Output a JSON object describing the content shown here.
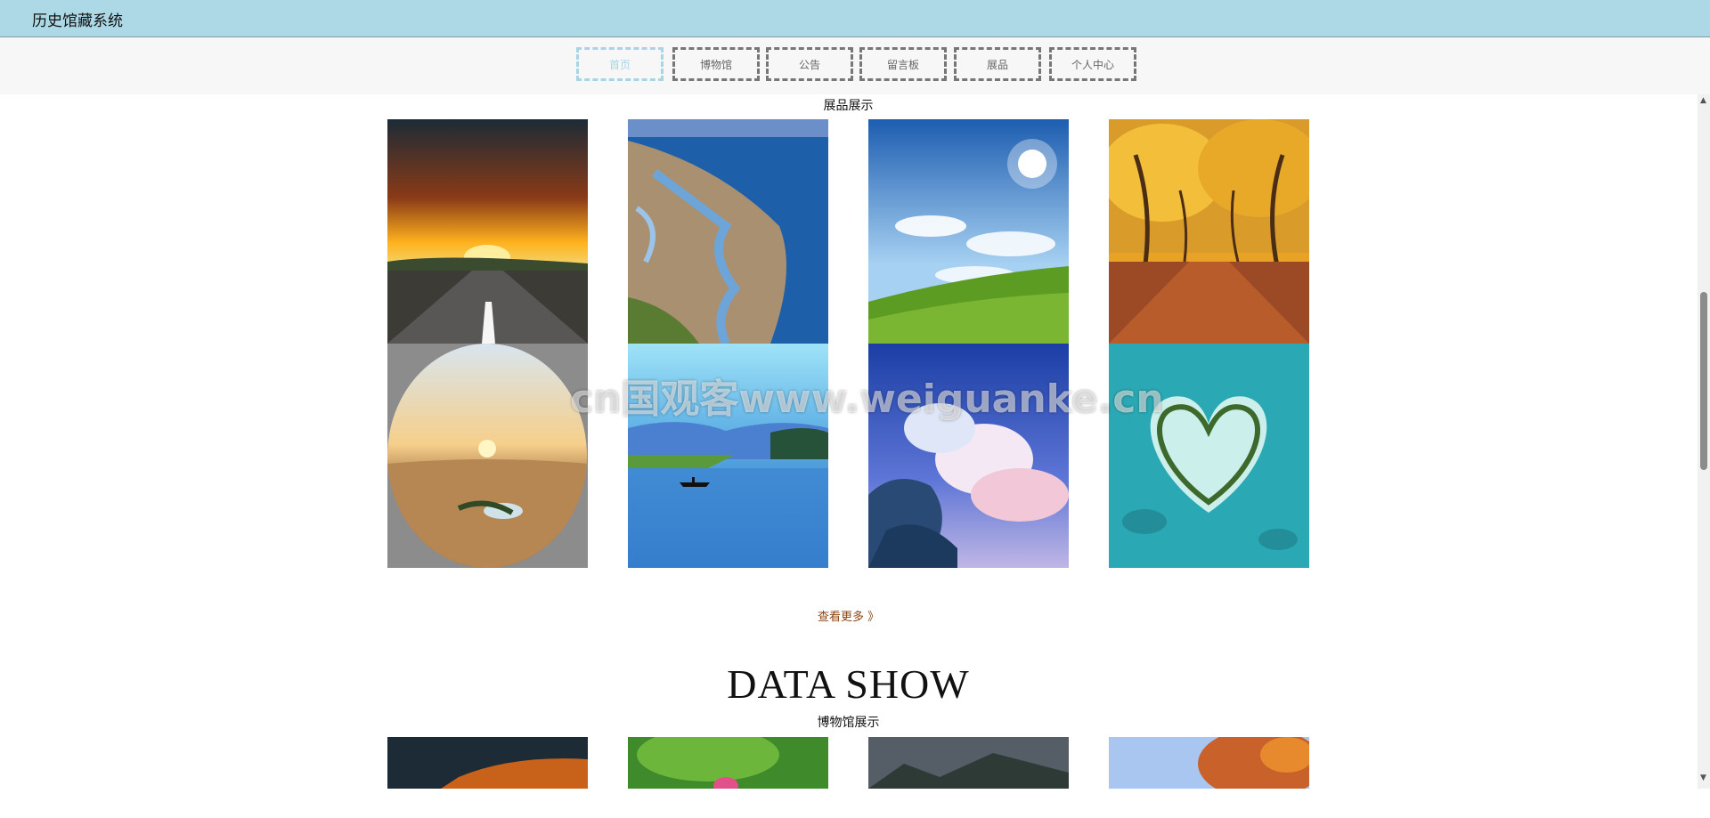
{
  "header": {
    "app_title": "历史馆藏系统"
  },
  "nav": {
    "items": [
      {
        "label": "首页",
        "active": true
      },
      {
        "label": "博物馆",
        "active": false
      },
      {
        "label": "公告",
        "active": false
      },
      {
        "label": "留言板",
        "active": false
      },
      {
        "label": "展品",
        "active": false
      },
      {
        "label": "个人中心",
        "active": false
      }
    ]
  },
  "exhibits": {
    "title": "展品展示",
    "more_label": "查看更多 》"
  },
  "data_show": {
    "title": "DATA SHOW"
  },
  "museums": {
    "title": "博物馆展示"
  },
  "watermark": "cn国观客www.weiguanke.cn",
  "colors": {
    "header_bg": "#add8e6",
    "active_nav": "#a8d4e6",
    "more_link": "#8b4513"
  }
}
